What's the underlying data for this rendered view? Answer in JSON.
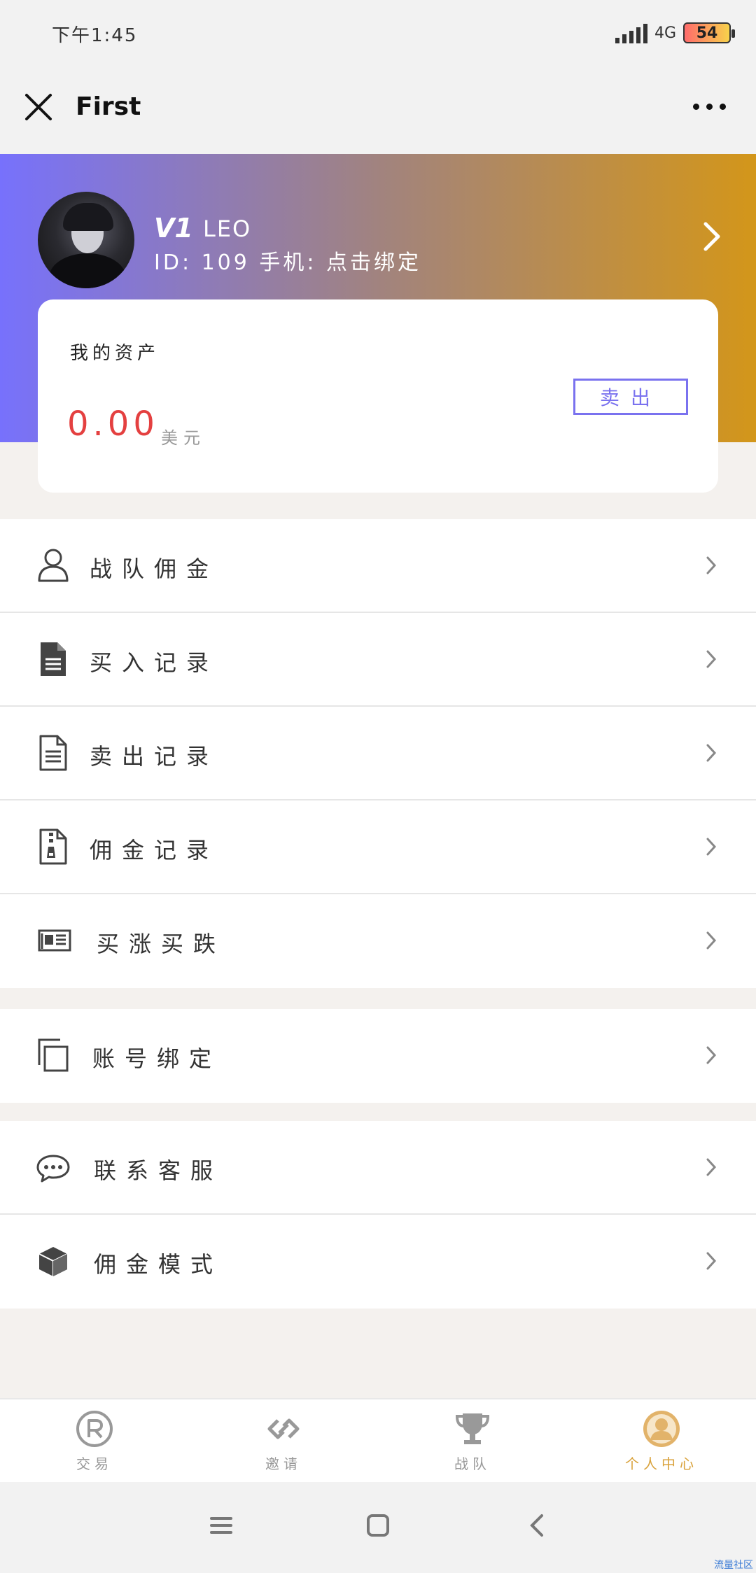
{
  "status": {
    "time": "下午1:45",
    "network": "4G",
    "battery": "54"
  },
  "nav": {
    "title": "First"
  },
  "profile": {
    "vip_badge": "V1",
    "username": "LEO",
    "id_line": "ID: 109 手机: 点击绑定"
  },
  "assets": {
    "title": "我的资产",
    "amount": "0.00",
    "unit": "美元",
    "sell_label": "卖出"
  },
  "menu_group1": [
    {
      "label": "战队佣金",
      "icon": "person-icon"
    },
    {
      "label": "买入记录",
      "icon": "document-filled-icon"
    },
    {
      "label": "卖出记录",
      "icon": "document-outline-icon"
    },
    {
      "label": "佣金记录",
      "icon": "zip-file-icon"
    },
    {
      "label": "买涨买跌",
      "icon": "newspaper-icon"
    }
  ],
  "menu_group2": [
    {
      "label": "账号绑定",
      "icon": "copy-icon"
    }
  ],
  "menu_group3": [
    {
      "label": "联系客服",
      "icon": "chat-icon"
    },
    {
      "label": "佣金模式",
      "icon": "cube-icon"
    }
  ],
  "tabs": [
    {
      "label": "交易",
      "icon": "registered-icon",
      "active": false
    },
    {
      "label": "邀请",
      "icon": "link-icon",
      "active": false
    },
    {
      "label": "战队",
      "icon": "trophy-icon",
      "active": false
    },
    {
      "label": "个人中心",
      "icon": "user-circle-icon",
      "active": true
    }
  ],
  "watermark": "流量社区",
  "colors": {
    "accent": "#7a72ef",
    "amount": "#e44040",
    "active_tab": "#d9a23b"
  }
}
